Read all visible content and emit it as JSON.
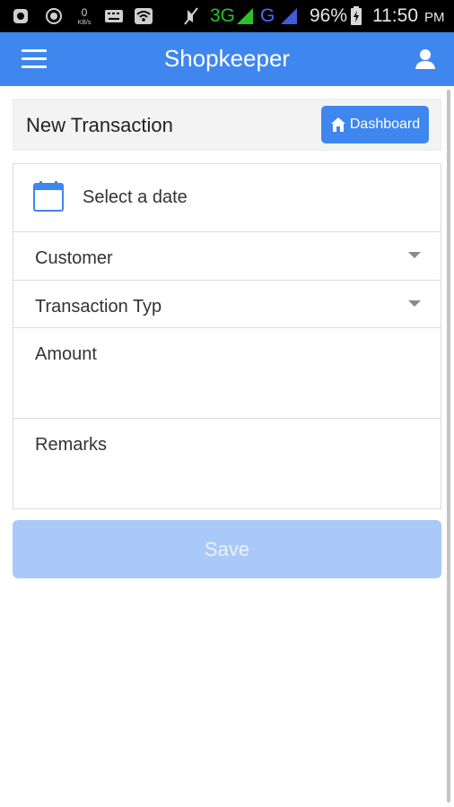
{
  "status_bar": {
    "network_3g": "3G",
    "network_g": "G",
    "battery": "96%",
    "time": "11:50",
    "time_suffix": "PM"
  },
  "app_bar": {
    "title": "Shopkeeper",
    "menu_icon": "hamburger-menu-icon",
    "user_icon": "user-icon",
    "color": "#3f86ef"
  },
  "header": {
    "title": "New Transaction",
    "dashboard_label": "Dashboard",
    "dashboard_icon": "home-icon"
  },
  "form": {
    "date_placeholder": "Select a date",
    "date_icon": "calendar-icon",
    "customer_label": "Customer",
    "transaction_type_label": "Transaction Typ",
    "amount_label": "Amount",
    "remarks_label": "Remarks"
  },
  "actions": {
    "save_label": "Save",
    "save_color": "#a9c9f8"
  }
}
